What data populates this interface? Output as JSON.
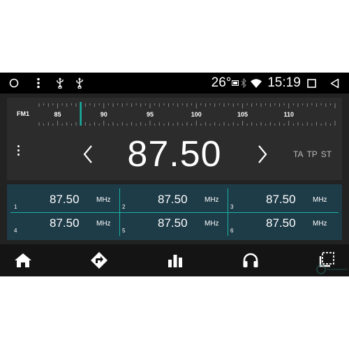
{
  "status_bar": {
    "temperature": "26°",
    "time": "15:19",
    "icons": [
      "circle-icon",
      "more-vert-icon",
      "usb-icon",
      "usb-icon",
      "weather-icon",
      "bluetooth-icon",
      "wifi-icon",
      "recents-square-icon",
      "back-triangle-icon"
    ]
  },
  "tuner": {
    "band": "FM1",
    "scale_labels": [
      "85",
      "90",
      "95",
      "100",
      "105",
      "110"
    ],
    "scale_range": [
      83,
      115
    ],
    "needle_frequency": 87.5,
    "frequency": "87.50",
    "rds": {
      "ta": "TA",
      "tp": "TP",
      "st": "ST"
    },
    "accent_color": "#17b3a3"
  },
  "presets": [
    {
      "num": "1",
      "freq": "87.50",
      "unit": "MHz"
    },
    {
      "num": "2",
      "freq": "87.50",
      "unit": "MHz"
    },
    {
      "num": "3",
      "freq": "87.50",
      "unit": "MHz"
    },
    {
      "num": "4",
      "freq": "87.50",
      "unit": "MHz"
    },
    {
      "num": "5",
      "freq": "87.50",
      "unit": "MHz"
    },
    {
      "num": "6",
      "freq": "87.50",
      "unit": "MHz"
    }
  ],
  "nav": [
    "home-icon",
    "navigation-icon",
    "equalizer-icon",
    "headphones-icon",
    "multiwindow-icon"
  ]
}
